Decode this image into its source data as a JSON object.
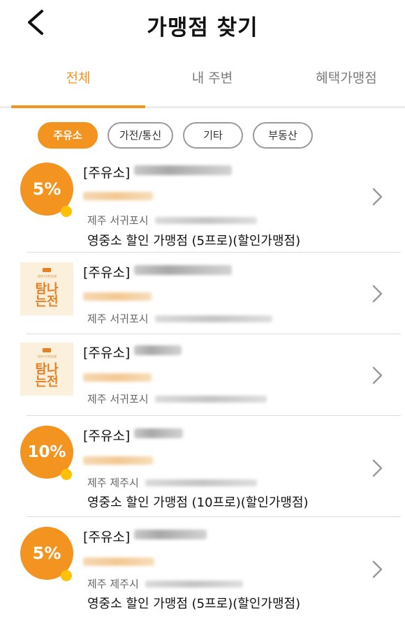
{
  "header": {
    "title": "가맹점 찾기",
    "back_icon": "back-arrow-icon"
  },
  "tabs": [
    {
      "label": "전체",
      "active": true
    },
    {
      "label": "내 주변",
      "active": false
    },
    {
      "label": "혜택가맹점",
      "active": false
    }
  ],
  "chips": [
    {
      "label": "주유소",
      "active": true
    },
    {
      "label": "가전/통신",
      "active": false
    },
    {
      "label": "기타",
      "active": false
    },
    {
      "label": "부동산",
      "active": false
    }
  ],
  "colors": {
    "accent": "#f39320",
    "badge_dot": "#ffc107",
    "inactive_text": "#7a7a7a"
  },
  "stores": [
    {
      "category": "[주유소]",
      "badge": "5%",
      "region": "제주 서귀포시",
      "promo": "영중소 할인 가맹점 (5프로)(할인가맹점)"
    },
    {
      "category": "[주유소]",
      "logo_text": "탐나는전",
      "region": "제주 서귀포시"
    },
    {
      "category": "[주유소]",
      "logo_text": "탐나는전",
      "region": "제주 서귀포시"
    },
    {
      "category": "[주유소]",
      "badge": "10%",
      "region": "제주 제주시",
      "promo": "영중소 할인 가맹점 (10프로)(할인가맹점)"
    },
    {
      "category": "[주유소]",
      "badge": "5%",
      "region": "제주 제주시",
      "promo": "영중소 할인 가맹점 (5프로)(할인가맹점)"
    }
  ]
}
